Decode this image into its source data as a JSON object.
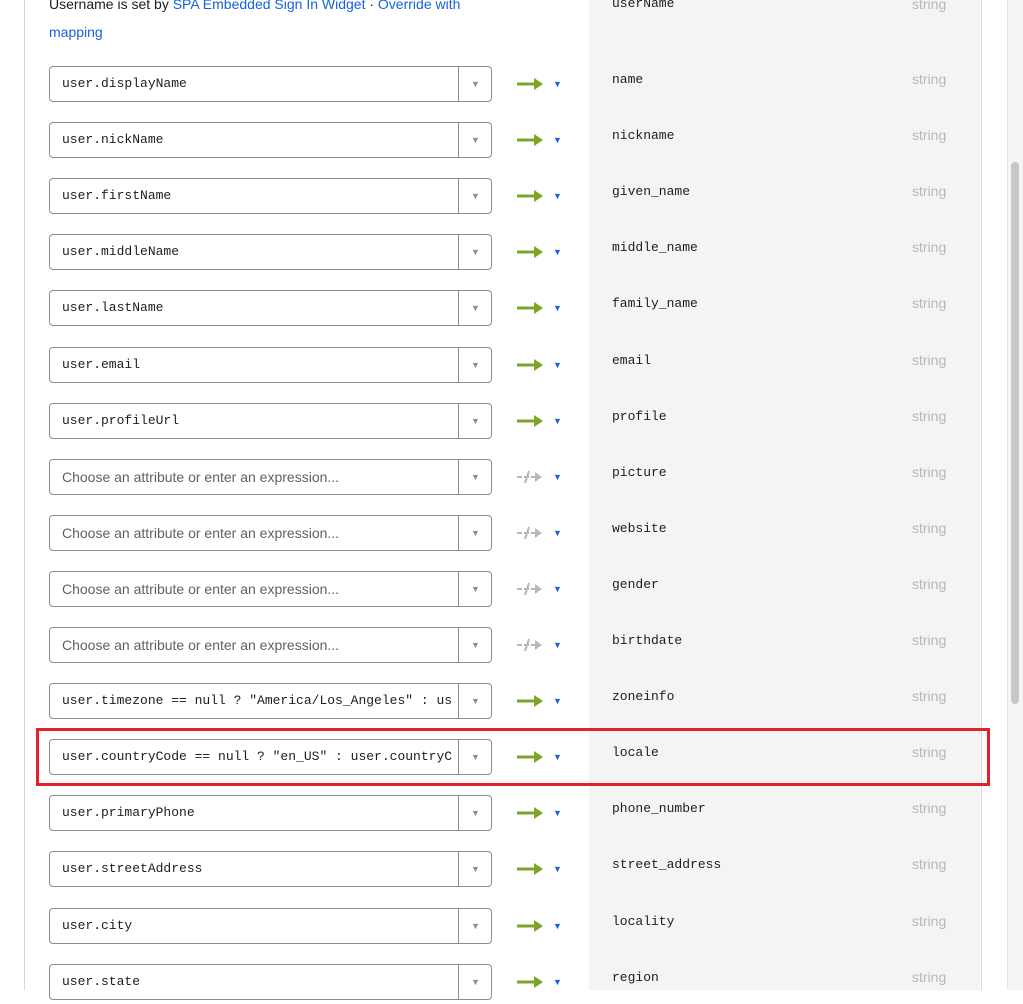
{
  "header": {
    "note_prefix": "Username is set by ",
    "note_link": "SPA Embedded Sign In Widget",
    "note_sep": " · ",
    "note_action": "Override with mapping",
    "username_claim": "userName",
    "username_type": "string"
  },
  "rows": [
    {
      "value": "user.displayName",
      "placeholder": false,
      "mapped": true,
      "claim": "name",
      "type": "string"
    },
    {
      "value": "user.nickName",
      "placeholder": false,
      "mapped": true,
      "claim": "nickname",
      "type": "string"
    },
    {
      "value": "user.firstName",
      "placeholder": false,
      "mapped": true,
      "claim": "given_name",
      "type": "string"
    },
    {
      "value": "user.middleName",
      "placeholder": false,
      "mapped": true,
      "claim": "middle_name",
      "type": "string"
    },
    {
      "value": "user.lastName",
      "placeholder": false,
      "mapped": true,
      "claim": "family_name",
      "type": "string"
    },
    {
      "value": "user.email",
      "placeholder": false,
      "mapped": true,
      "claim": "email",
      "type": "string"
    },
    {
      "value": "user.profileUrl",
      "placeholder": false,
      "mapped": true,
      "claim": "profile",
      "type": "string"
    },
    {
      "value": "Choose an attribute or enter an expression...",
      "placeholder": true,
      "mapped": false,
      "claim": "picture",
      "type": "string"
    },
    {
      "value": "Choose an attribute or enter an expression...",
      "placeholder": true,
      "mapped": false,
      "claim": "website",
      "type": "string"
    },
    {
      "value": "Choose an attribute or enter an expression...",
      "placeholder": true,
      "mapped": false,
      "claim": "gender",
      "type": "string"
    },
    {
      "value": "Choose an attribute or enter an expression...",
      "placeholder": true,
      "mapped": false,
      "claim": "birthdate",
      "type": "string"
    },
    {
      "value": "user.timezone == null ? \"America/Los_Angeles\" : use",
      "placeholder": false,
      "mapped": true,
      "claim": "zoneinfo",
      "type": "string"
    },
    {
      "value": "user.countryCode == null ? \"en_US\" : user.countryC",
      "placeholder": false,
      "mapped": true,
      "claim": "locale",
      "type": "string",
      "highlighted": true
    },
    {
      "value": "user.primaryPhone",
      "placeholder": false,
      "mapped": true,
      "claim": "phone_number",
      "type": "string"
    },
    {
      "value": "user.streetAddress",
      "placeholder": false,
      "mapped": true,
      "claim": "street_address",
      "type": "string"
    },
    {
      "value": "user.city",
      "placeholder": false,
      "mapped": true,
      "claim": "locality",
      "type": "string"
    },
    {
      "value": "user.state",
      "placeholder": false,
      "mapped": true,
      "claim": "region",
      "type": "string"
    }
  ],
  "colors": {
    "mapped_arrow": "#7ba428",
    "unmapped_arrow": "#b7b7bb",
    "direction_caret": "#1662dd",
    "highlight_border": "#e3212b"
  },
  "icons": {
    "mapped": "arrow-right-icon",
    "unmapped": "no-mapping-arrow-icon",
    "caret": "chevron-down-icon",
    "direction": "caret-down-icon"
  }
}
